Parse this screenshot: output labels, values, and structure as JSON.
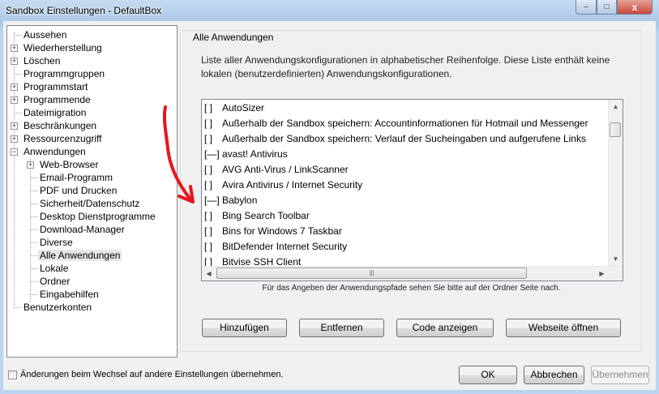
{
  "window": {
    "title": "Sandbox Einstellungen - DefaultBox",
    "close_glyph": "x",
    "min_glyph": "–",
    "max_glyph": "□"
  },
  "tree": {
    "items": [
      {
        "label": "Aussehen",
        "expander": ""
      },
      {
        "label": "Wiederherstellung",
        "expander": "+"
      },
      {
        "label": "Löschen",
        "expander": "+"
      },
      {
        "label": "Programmgruppen",
        "expander": ""
      },
      {
        "label": "Programmstart",
        "expander": "+"
      },
      {
        "label": "Programmende",
        "expander": "+"
      },
      {
        "label": "Dateimigration",
        "expander": ""
      },
      {
        "label": "Beschränkungen",
        "expander": "+"
      },
      {
        "label": "Ressourcenzugriff",
        "expander": "+"
      },
      {
        "label": "Anwendungen",
        "expander": "−"
      },
      {
        "label": "Web-Browser",
        "expander": "+"
      },
      {
        "label": "Email-Programm",
        "expander": ""
      },
      {
        "label": "PDF und Drucken",
        "expander": ""
      },
      {
        "label": "Sicherheit/Datenschutz",
        "expander": ""
      },
      {
        "label": "Desktop Dienstprogramme",
        "expander": ""
      },
      {
        "label": "Download-Manager",
        "expander": ""
      },
      {
        "label": "Diverse",
        "expander": ""
      },
      {
        "label": "Alle Anwendungen",
        "expander": ""
      },
      {
        "label": "Lokale",
        "expander": ""
      },
      {
        "label": "Ordner",
        "expander": ""
      },
      {
        "label": "Eingabehilfen",
        "expander": ""
      },
      {
        "label": "Benutzerkonten",
        "expander": ""
      }
    ]
  },
  "panel": {
    "title": "Alle Anwendungen",
    "description": "Liste aller Anwendungskonfigurationen in alphabetischer Reihenfolge. Diese Liste enthält keine lokalen (benutzerdefinierten) Anwendungskonfigurationen.",
    "hint": "Für das Angeben der Anwendungspfade sehen Sie bitte auf der Ordner Seite nach."
  },
  "list": {
    "items": [
      {
        "check": "[  ]",
        "label": "AutoSizer"
      },
      {
        "check": "[  ]",
        "label": "Außerhalb der Sandbox speichern: Accountinformationen für Hotmail und Messenger"
      },
      {
        "check": "[  ]",
        "label": "Außerhalb der Sandbox speichern: Verlauf der Sucheingaben und aufgerufene Links"
      },
      {
        "check": "[—]",
        "label": "avast! Antivirus"
      },
      {
        "check": "[  ]",
        "label": "AVG Anti-Virus / LinkScanner"
      },
      {
        "check": "[  ]",
        "label": "Avira Antivirus / Internet Security"
      },
      {
        "check": "[—]",
        "label": "Babylon"
      },
      {
        "check": "[  ]",
        "label": "Bing Search Toolbar"
      },
      {
        "check": "[  ]",
        "label": "Bins for Windows 7 Taskbar"
      },
      {
        "check": "[  ]",
        "label": "BitDefender Internet Security"
      },
      {
        "check": "[  ]",
        "label": "Bitvise SSH Client"
      }
    ]
  },
  "buttons": {
    "add": "Hinzufügen",
    "remove": "Entfernen",
    "show_code": "Code anzeigen",
    "open_web": "Webseite öffnen",
    "ok": "OK",
    "cancel": "Abbrechen",
    "apply": "Übernehmen"
  },
  "footer": {
    "checkbox_label": "Änderungen beim Wechsel auf andere Einstellungen übernehmen."
  },
  "annotation": {
    "color": "#e8141c"
  }
}
